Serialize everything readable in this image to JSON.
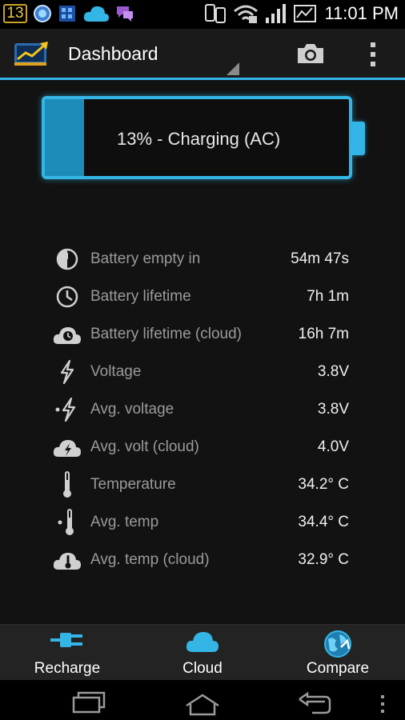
{
  "status_bar": {
    "notification_count": "13",
    "time": "11:01 PM"
  },
  "action_bar": {
    "title": "Dashboard"
  },
  "battery": {
    "level_percent": 13,
    "status_text": "13% - Charging (AC)",
    "color": "#33b5e5"
  },
  "stats": [
    {
      "icon": "pie-clock-icon",
      "label": "Battery empty in",
      "value": "54m 47s"
    },
    {
      "icon": "clock-icon",
      "label": "Battery lifetime",
      "value": "7h 1m"
    },
    {
      "icon": "cloud-clock-icon",
      "label": "Battery lifetime (cloud)",
      "value": "16h 7m"
    },
    {
      "icon": "lightning-icon",
      "label": "Voltage",
      "value": "3.8V"
    },
    {
      "icon": "avg-lightning-icon",
      "label": "Avg. voltage",
      "value": "3.8V"
    },
    {
      "icon": "cloud-lightning-icon",
      "label": "Avg. volt (cloud)",
      "value": "4.0V"
    },
    {
      "icon": "thermometer-icon",
      "label": "Temperature",
      "value": "34.2° C"
    },
    {
      "icon": "avg-thermometer-icon",
      "label": "Avg. temp",
      "value": "34.4° C"
    },
    {
      "icon": "cloud-thermometer-icon",
      "label": "Avg. temp (cloud)",
      "value": "32.9° C"
    }
  ],
  "tabs": [
    {
      "icon": "plug-icon",
      "label": "Recharge"
    },
    {
      "icon": "cloud-icon",
      "label": "Cloud"
    },
    {
      "icon": "globe-icon",
      "label": "Compare"
    }
  ]
}
